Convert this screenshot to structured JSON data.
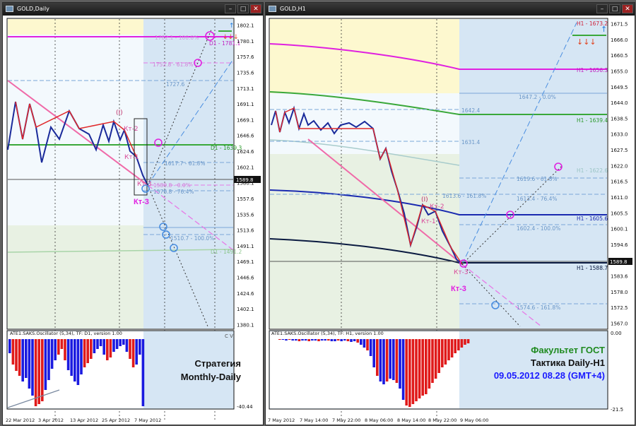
{
  "windows": {
    "daily": {
      "title": "GOLD,Daily",
      "price_axis": [
        "1802.1",
        "1780.1",
        "1757.6",
        "1735.6",
        "1713.1",
        "1691.1",
        "1669.1",
        "1646.6",
        "1624.6",
        "1602.1",
        "1580.1",
        "1557.6",
        "1535.6",
        "1513.6",
        "1491.1",
        "1469.1",
        "1446.6",
        "1424.6",
        "1402.1",
        "1380.1"
      ],
      "current_price": "1589.8",
      "levels": {
        "d1_top": "D1 - 1781.1",
        "d1_green": "D1 - 1639.3",
        "d1_low": "D1 - 1491.2",
        "fib_1782": "1782.1 - 100.0%",
        "fib_1752": "1752.8 - 61.8%",
        "fib_1727": "1727.6",
        "fib_1617": "1617.7 - 61.8%",
        "fib_1589": "1589.8 - 0.0%",
        "fib_1576": "1576.8 - 76.4%",
        "fib_1510": "1510.7 - 100.0%"
      },
      "annotations": [
        "(I)",
        "Кт-2",
        "Кт-1",
        "Кт-3",
        "Кт-3"
      ],
      "oscillator": {
        "title": "ATE1.SAKS.Oscillator (5,34), TF: D1, version 1.00",
        "axis_bottom": "-40.44",
        "marker": "C V"
      },
      "time_axis": [
        "22 Mar 2012",
        "3 Apr 2012",
        "13 Apr 2012",
        "25 Apr 2012",
        "7 May 2012"
      ],
      "caption": [
        "Стратегия",
        "Monthly-Daily"
      ]
    },
    "h1": {
      "title": "GOLD,H1",
      "price_axis": [
        "1671.5",
        "1666.0",
        "1660.5",
        "1655.0",
        "1649.5",
        "1644.0",
        "1638.5",
        "1633.0",
        "1627.5",
        "1622.0",
        "1616.5",
        "1611.0",
        "1605.5",
        "1600.1",
        "1594.6",
        "1589.1",
        "1583.6",
        "1578.0",
        "1572.5",
        "1567.0"
      ],
      "current_price": "1589.8",
      "levels": {
        "h1_top": "H1 - 1673.2",
        "h1_magenta": "H1 - 1656.3",
        "h1_green": "H1 - 1639.4",
        "h1_gray": "H1 - 1622.6",
        "h1_blue": "H1 - 1605.6",
        "h1_dark": "H1 - 1588.7",
        "fib_1647": "1647.2 - 0.0%",
        "fib_1642": "1642.4",
        "fib_1631": "1631.4",
        "fib_1619": "1619.6 - 61.8%",
        "fib_1613a": "1613.6 - 161.8%",
        "fib_1613b": "1613.4 - 76.4%",
        "fib_1602": "1602.4 - 100.0%",
        "fib_1574": "1574.6 - 161.8%"
      },
      "annotations": [
        "(I)",
        "Кт-2",
        "Кт-1",
        "Кт-3",
        "Кт-3"
      ],
      "oscillator": {
        "title": "ATE1.SAKS.Oscillator (5,34), TF: H1, version 1.00",
        "axis_top": "0.00",
        "axis_bottom": "-21.5"
      },
      "time_axis": [
        "7 May 2012",
        "7 May 14:00",
        "7 May 22:00",
        "8 May 06:00",
        "8 May 14:00",
        "8 May 22:00",
        "9 May 06:00"
      ],
      "caption": [
        "Факультет ГОСТ",
        "Тактика Daily-H1",
        "09.05.2012 08.28 (GMT+4)"
      ]
    }
  },
  "colors": {
    "up_arrow": "#1e7be0",
    "down_arrow": "#e0421e",
    "magenta": "#e020e0",
    "green": "#3aa83a",
    "caption_green": "#1f8a1f",
    "caption_blue": "#1a1aff"
  },
  "window_buttons": [
    "–",
    "□",
    "✕"
  ]
}
